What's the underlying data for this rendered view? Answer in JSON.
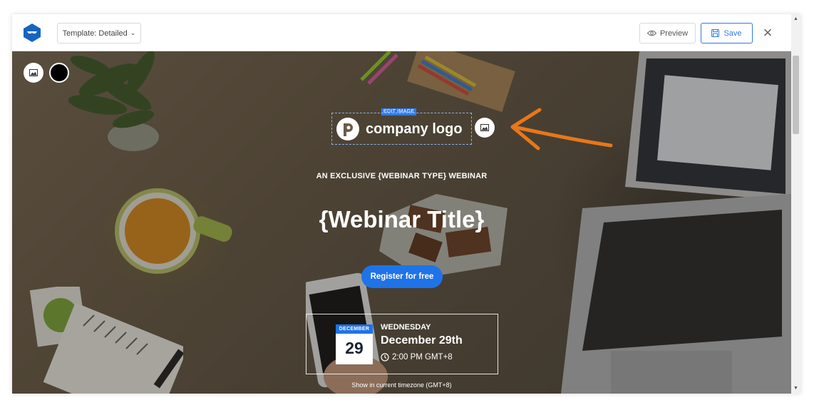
{
  "toolbar": {
    "template_label": "Template: Detailed",
    "template_chevron": "⌄",
    "preview_label": "Preview",
    "save_label": "Save",
    "close_icon": "×"
  },
  "logo": {
    "edit_tag": "EDIT IMAGE",
    "company_text": "company logo"
  },
  "hero": {
    "subtitle": "AN EXCLUSIVE {WEBINAR TYPE} WEBINAR",
    "title": "{Webinar Title}",
    "register_label": "Register for free",
    "timezone_note": "Show in current timezone (GMT+8)"
  },
  "date_card": {
    "month": "DECEMBER",
    "day": "29",
    "weekday": "WEDNESDAY",
    "date": "December 29th",
    "time": "2:00 PM GMT+8"
  },
  "scrollbar": {
    "up": "▲",
    "down": "▼"
  },
  "colors": {
    "accent": "#1f73e8",
    "brand": "#1565c0",
    "arrow": "#e8771a"
  }
}
